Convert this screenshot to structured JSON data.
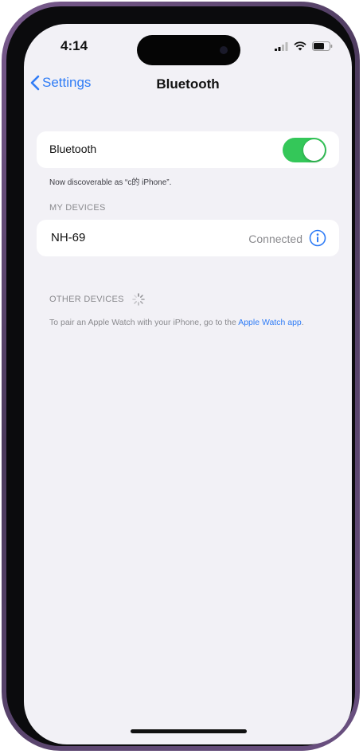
{
  "status_bar": {
    "time": "4:14",
    "icons": [
      "cellular-signal-icon",
      "wifi-icon",
      "battery-icon"
    ]
  },
  "nav": {
    "back_label": "Settings",
    "title": "Bluetooth"
  },
  "bluetooth": {
    "label": "Bluetooth",
    "toggle_on": true,
    "discoverable_text": "Now discoverable as “c的 iPhone”."
  },
  "my_devices": {
    "header": "MY DEVICES",
    "items": [
      {
        "name": "NH-69",
        "status": "Connected"
      }
    ]
  },
  "other_devices": {
    "header": "OTHER DEVICES",
    "pair_note_prefix": "To pair an Apple Watch with your iPhone, go to the ",
    "pair_note_link": "Apple Watch app",
    "pair_note_suffix": "."
  },
  "colors": {
    "accent": "#2f7cf6",
    "toggle_on": "#34c759",
    "background": "#f2f1f6",
    "frame": "#6a5080"
  }
}
